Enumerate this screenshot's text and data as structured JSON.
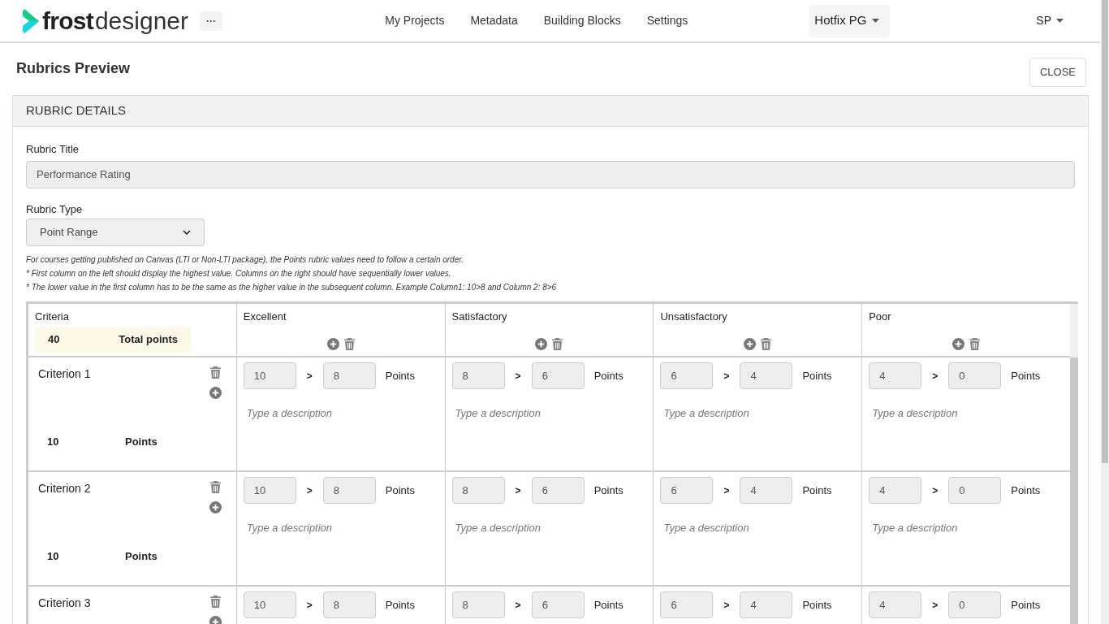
{
  "header": {
    "logo": {
      "bold": "frost",
      "light": "designer"
    },
    "more": "···",
    "nav": [
      {
        "label": "My Projects"
      },
      {
        "label": "Metadata"
      },
      {
        "label": "Building Blocks"
      },
      {
        "label": "Settings"
      }
    ],
    "project": "Hotfix PG",
    "user": "SP"
  },
  "page": {
    "title": "Rubrics Preview",
    "close": "CLOSE"
  },
  "details": {
    "heading": "RUBRIC DETAILS",
    "title_label": "Rubric Title",
    "title_value": "Performance Rating",
    "type_label": "Rubric Type",
    "type_value": "Point Range",
    "notes": [
      "For courses getting published on Canvas (LTI or Non-LTI package), the Points rubric values need to follow a certain order.",
      "* First column on the left should display the highest value. Columns on the right should have sequentially lower values.",
      "* The lower value in the first column has to be the same as the higher value in the subsequent column. Example Column1: 10>8 and Column 2: 8>6"
    ]
  },
  "table": {
    "criteria_label": "Criteria",
    "total": "40",
    "total_label": "Total points",
    "columns": [
      {
        "label": "Excellent"
      },
      {
        "label": "Satisfactory"
      },
      {
        "label": "Unsatisfactory"
      },
      {
        "label": "Poor"
      }
    ],
    "rows": [
      {
        "name": "Criterion 1",
        "points": "10",
        "points_label": "Points",
        "cells": [
          {
            "high": "10",
            "sep": ">",
            "low": "8",
            "unit": "Points",
            "placeholder": "Type a description"
          },
          {
            "high": "8",
            "sep": ">",
            "low": "6",
            "unit": "Points",
            "placeholder": "Type a description"
          },
          {
            "high": "6",
            "sep": ">",
            "low": "4",
            "unit": "Points",
            "placeholder": "Type a description"
          },
          {
            "high": "4",
            "sep": ">",
            "low": "0",
            "unit": "Points",
            "placeholder": "Type a description"
          }
        ]
      },
      {
        "name": "Criterion 2",
        "points": "10",
        "points_label": "Points",
        "cells": [
          {
            "high": "10",
            "sep": ">",
            "low": "8",
            "unit": "Points",
            "placeholder": "Type a description"
          },
          {
            "high": "8",
            "sep": ">",
            "low": "6",
            "unit": "Points",
            "placeholder": "Type a description"
          },
          {
            "high": "6",
            "sep": ">",
            "low": "4",
            "unit": "Points",
            "placeholder": "Type a description"
          },
          {
            "high": "4",
            "sep": ">",
            "low": "0",
            "unit": "Points",
            "placeholder": "Type a description"
          }
        ]
      },
      {
        "name": "Criterion 3",
        "cells": [
          {
            "high": "10",
            "sep": ">",
            "low": "8",
            "unit": "Points"
          },
          {
            "high": "8",
            "sep": ">",
            "low": "6",
            "unit": "Points"
          },
          {
            "high": "6",
            "sep": ">",
            "low": "4",
            "unit": "Points"
          },
          {
            "high": "4",
            "sep": ">",
            "low": "0",
            "unit": "Points"
          }
        ]
      }
    ]
  }
}
